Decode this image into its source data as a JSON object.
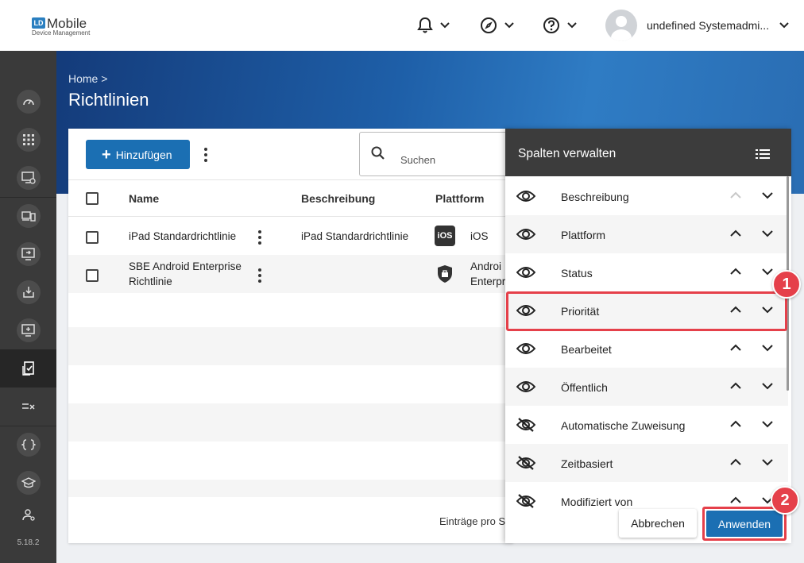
{
  "app": {
    "logo_badge": "LD",
    "logo_name": "Mobile",
    "logo_sub": "Device Management",
    "user_name": "undefined Systemadmi...",
    "version": "5.18.2"
  },
  "sidebar": {
    "items": [
      {
        "icon": "dashboard-icon"
      },
      {
        "icon": "apps-grid-icon"
      },
      {
        "icon": "device-settings-icon"
      },
      {
        "icon": "devices-icon"
      },
      {
        "icon": "remote-screen-icon"
      },
      {
        "icon": "download-icon"
      },
      {
        "icon": "add-screen-icon"
      },
      {
        "icon": "policy-icon",
        "active": true
      },
      {
        "icon": "compliance-icon"
      },
      {
        "icon": "code-braces-icon"
      },
      {
        "icon": "education-icon"
      },
      {
        "icon": "user-settings-icon"
      }
    ]
  },
  "header": {
    "breadcrumb": "Home >",
    "title": "Richtlinien"
  },
  "toolbar": {
    "add_label": "Hinzufügen",
    "search_placeholder": "Suchen"
  },
  "table": {
    "columns": [
      "Name",
      "Beschreibung",
      "Plattform"
    ],
    "rows": [
      {
        "name": "iPad Standardrichtlinie",
        "description": "iPad Standardrichtlinie",
        "platform_icon": "iOS",
        "platform": "iOS"
      },
      {
        "name_line1": "SBE Android Enterprise",
        "name_line2": "Richtlinie",
        "description": "",
        "platform_line1": "Androi",
        "platform_line2": "Enterpr"
      }
    ],
    "footer_text": "Einträge pro S"
  },
  "panel": {
    "title": "Spalten verwalten",
    "columns": [
      {
        "label": "Beschreibung",
        "visible": true
      },
      {
        "label": "Plattform",
        "visible": true
      },
      {
        "label": "Status",
        "visible": true
      },
      {
        "label": "Priorität",
        "visible": true
      },
      {
        "label": "Bearbeitet",
        "visible": true
      },
      {
        "label": "Öffentlich",
        "visible": true
      },
      {
        "label": "Automatische Zuweisung",
        "visible": false
      },
      {
        "label": "Zeitbasiert",
        "visible": false
      },
      {
        "label": "Modifiziert von",
        "visible": false
      }
    ],
    "cancel_label": "Abbrechen",
    "apply_label": "Anwenden"
  },
  "callouts": {
    "one": "1",
    "two": "2"
  },
  "colors": {
    "accent": "#1b6fb3",
    "highlight": "#e5404a",
    "sidebar": "#3a3a3a"
  }
}
